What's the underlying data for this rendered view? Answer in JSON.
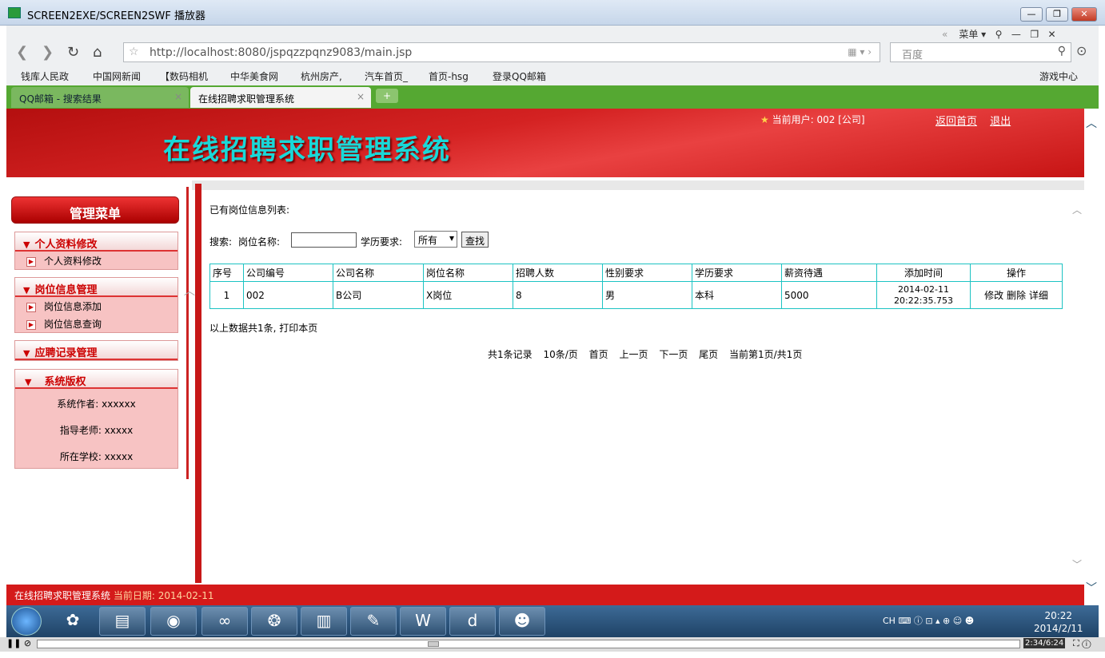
{
  "window": {
    "title": "SCREEN2EXE/SCREEN2SWF 播放器"
  },
  "browser": {
    "url": "http://localhost:8080/jspqzzpqnz9083/main.jsp",
    "menu_label": "菜单",
    "search_placeholder": "百度",
    "bookmarks": [
      "钱库人民政",
      "中国网新闻",
      "【数码相机",
      "中华美食网",
      "杭州房产,",
      "汽车首页_",
      "首页-hsg",
      "登录QQ邮箱"
    ],
    "game_center": "游戏中心",
    "tabs": [
      {
        "label": "QQ邮箱 - 搜索结果"
      },
      {
        "label": "在线招聘求职管理系统"
      }
    ]
  },
  "header": {
    "system_title": "在线招聘求职管理系统",
    "current_user": "当前用户: 002 [公司]",
    "home_link": "返回首页",
    "logout_link": "退出"
  },
  "sidebar": {
    "title": "管理菜单",
    "groups": [
      {
        "title": "个人资料修改",
        "items": [
          "个人资料修改"
        ]
      },
      {
        "title": "岗位信息管理",
        "items": [
          "岗位信息添加",
          "岗位信息查询"
        ]
      },
      {
        "title": "应聘记录管理",
        "items": []
      }
    ],
    "copyright": {
      "title": "系统版权",
      "author": "系统作者: xxxxxx",
      "advisor": "指导老师: xxxxx",
      "school": "所在学校: xxxxx"
    }
  },
  "main": {
    "list_title": "已有岗位信息列表:",
    "search_label": "搜索:",
    "position_label": "岗位名称:",
    "keyword_value": "",
    "edu_label": "学历要求:",
    "edu_selected": "所有",
    "find_button": "查找",
    "table": {
      "headers": [
        "序号",
        "公司编号",
        "公司名称",
        "岗位名称",
        "招聘人数",
        "性别要求",
        "学历要求",
        "薪资待遇",
        "添加时间",
        "操作"
      ],
      "rows": [
        {
          "no": "1",
          "company_id": "002",
          "company_name": "B公司",
          "position": "X岗位",
          "count": "8",
          "gender": "男",
          "education": "本科",
          "salary": "5000",
          "time_date": "2014-02-11",
          "time_clock": "20:22:35.753",
          "edit": "修改",
          "delete": "删除",
          "detail": "详细"
        }
      ]
    },
    "summary": "以上数据共1条, 打印本页",
    "pager": [
      "共1条记录",
      "10条/页",
      "首页",
      "上一页",
      "下一页",
      "尾页",
      "当前第1页/共1页"
    ]
  },
  "footer": {
    "system": "在线招聘求职管理系统",
    "date_label": "当前日期:",
    "date": "2014-02-11"
  },
  "taskbar": {
    "lang": "CH",
    "time": "20:22",
    "date": "2014/2/11"
  },
  "player": {
    "time": "2:34/6:24"
  }
}
